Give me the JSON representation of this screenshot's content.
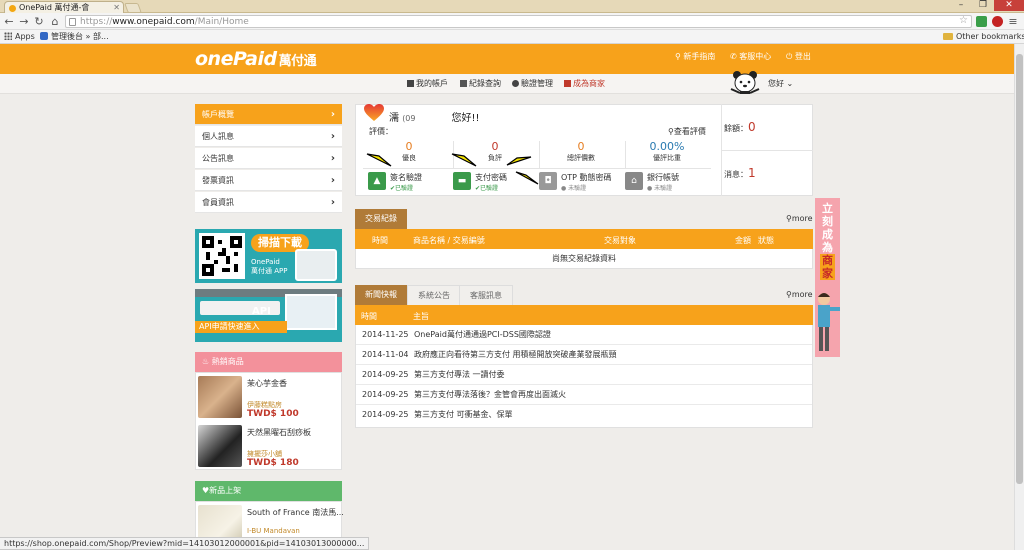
{
  "browser": {
    "tab_title": "OnePaid 萬付通-會",
    "url_scheme": "https://",
    "url_host": "www.onepaid.com",
    "url_path": "/Main/Home",
    "bookmarks": [
      {
        "label": "Apps"
      },
      {
        "label": "管理後台 » 部..."
      }
    ],
    "other_bookmarks": "Other bookmarks",
    "status_url": "https://shop.onepaid.com/Shop/Preview?mid=14103012000001&pid=14103013000000..."
  },
  "header": {
    "logo_text": "onePaid",
    "logo_cn": "萬付通",
    "links": [
      {
        "label": "新手指南",
        "icon": "pin-icon"
      },
      {
        "label": "客服中心",
        "icon": "phone-icon"
      },
      {
        "label": "登出",
        "icon": "power-icon"
      }
    ],
    "accent_color": "#f7a21b"
  },
  "subnav": {
    "items": [
      {
        "label": "我的帳戶"
      },
      {
        "label": "紀錄查詢"
      },
      {
        "label": "驗證管理"
      },
      {
        "label": "成為商家"
      }
    ],
    "greeting": "您好"
  },
  "sidebar": {
    "items": [
      {
        "label": "帳戶概覽",
        "active": true
      },
      {
        "label": "個人訊息"
      },
      {
        "label": "公告訊息"
      },
      {
        "label": "發票資訊"
      },
      {
        "label": "會員資訊"
      }
    ],
    "promo_app": {
      "button": "掃描下載",
      "line1": "OnePaid",
      "line2": "萬付通 APP"
    },
    "promo_api": {
      "tag": "API",
      "text": "API申請快速進入"
    },
    "hot": {
      "title": "熱銷商品",
      "products": [
        {
          "name": "茉心芋金香",
          "shop": "伊藤糕點房",
          "price": "TWD$ 100"
        },
        {
          "name": "天然黑曜石刮痧板",
          "shop": "擁擺莎小舖",
          "price": "TWD$ 180"
        }
      ]
    },
    "new": {
      "title": "新品上架",
      "products": [
        {
          "name": "South of France 南法馬...",
          "shop": "I-BU Mandavan"
        }
      ]
    }
  },
  "profile": {
    "name": "濡",
    "phone": "(09",
    "greeting": "您好!!",
    "rating_label": "評價：",
    "view_rating": "查看評價",
    "stats": [
      {
        "value": "0",
        "label": "優良",
        "color": "#e67e22"
      },
      {
        "value": "0",
        "label": "負評",
        "color": "#c0392b"
      },
      {
        "value": "0",
        "label": "總評價數",
        "color": "#e67e22"
      },
      {
        "value": "0.00%",
        "label": "優評比重",
        "color": "#2a7ab0"
      }
    ],
    "verifications": [
      {
        "label": "簽名驗證",
        "status": "已驗證",
        "ok": true,
        "color": "#3a9a4a"
      },
      {
        "label": "支付密碼",
        "status": "已驗證",
        "ok": true,
        "color": "#3a9a4a"
      },
      {
        "label": "OTP 動態密碼",
        "status": "未驗證",
        "ok": false,
        "color": "#999999"
      },
      {
        "label": "銀行帳號",
        "status": "未驗證",
        "ok": false,
        "color": "#888888"
      }
    ],
    "balance_label": "餘額：",
    "balance_value": "0",
    "messages_label": "消息：",
    "messages_value": "1"
  },
  "transactions": {
    "tab": "交易紀錄",
    "more": "more",
    "columns": [
      "時間",
      "商品名稱 / 交易編號",
      "交易對象",
      "金額",
      "狀態"
    ],
    "empty": "尚無交易紀錄資料"
  },
  "news": {
    "tabs": [
      "新聞快報",
      "系統公告",
      "客服訊息"
    ],
    "more": "more",
    "columns": [
      "時間",
      "主旨"
    ],
    "rows": [
      {
        "date": "2014-11-25",
        "title": "OnePaid萬付通通過PCI-DSS國際認證"
      },
      {
        "date": "2014-11-04",
        "title": "政府應正向看待第三方支付 用積極開放突破產業發展瓶頸"
      },
      {
        "date": "2014-09-25",
        "title": "第三方支付專法 一讀付委"
      },
      {
        "date": "2014-09-25",
        "title": "第三方支付專法落後？金管會再度出面滅火"
      },
      {
        "date": "2014-09-25",
        "title": "第三方支付 可衝基金、保單"
      }
    ]
  },
  "banner": {
    "chars": [
      "立",
      "刻",
      "成",
      "為",
      "商",
      "家"
    ]
  }
}
